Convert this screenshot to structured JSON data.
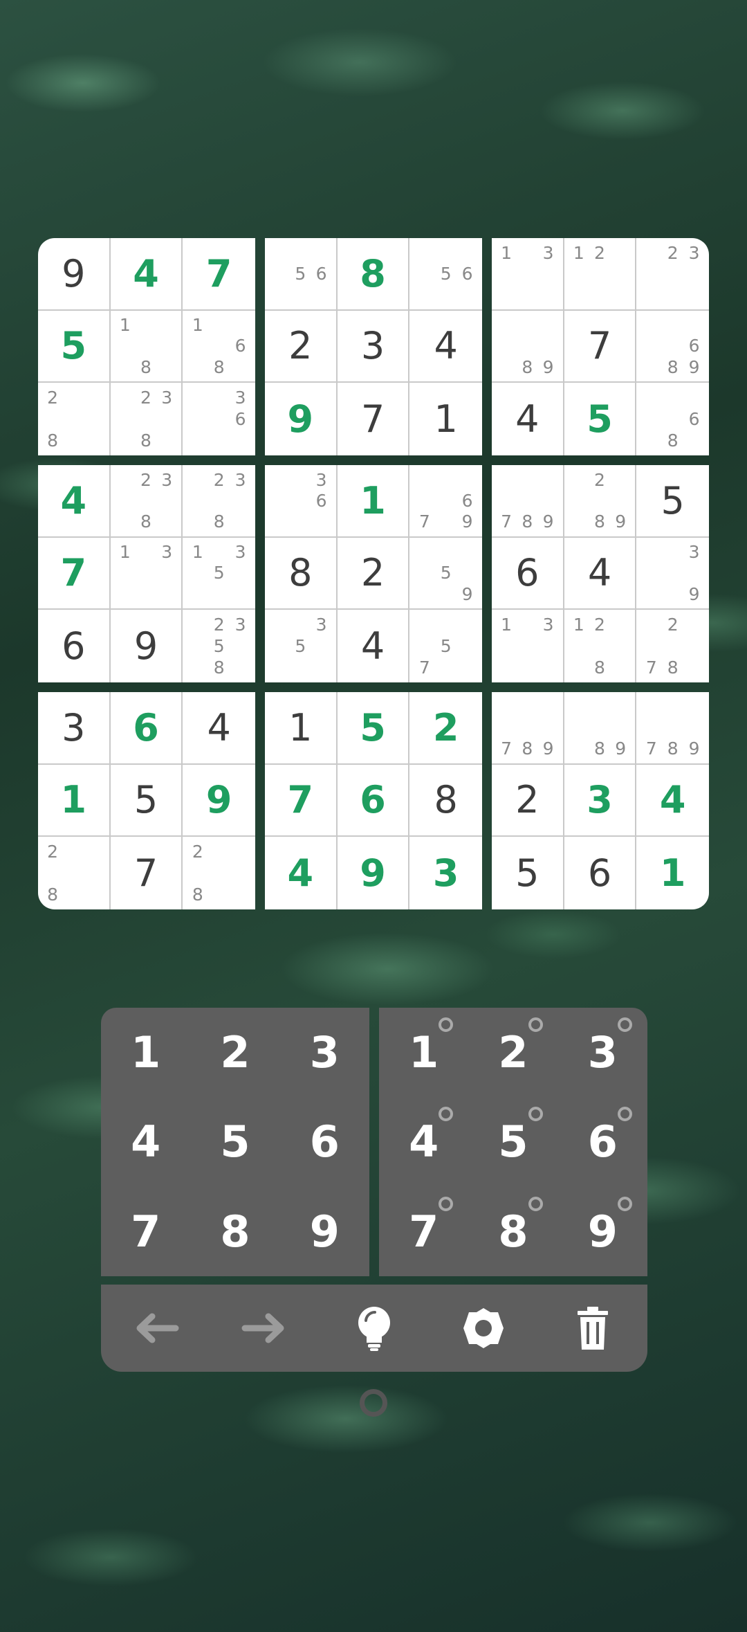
{
  "board": {
    "blocks": [
      {
        "cells": [
          {
            "v": "9",
            "t": "given"
          },
          {
            "v": "4",
            "t": "entered"
          },
          {
            "v": "7",
            "t": "entered"
          },
          {
            "v": "5",
            "t": "entered"
          },
          {
            "notes": [
              "1",
              "",
              "",
              "",
              "",
              "",
              "",
              "8",
              ""
            ]
          },
          {
            "notes": [
              "1",
              "",
              "",
              "",
              "",
              "6",
              "",
              "8",
              ""
            ]
          },
          {
            "notes": [
              "2",
              "",
              "",
              "",
              "",
              "",
              "8",
              "",
              ""
            ]
          },
          {
            "notes": [
              "",
              "2",
              "3",
              "",
              "",
              "",
              "",
              "8",
              ""
            ]
          },
          {
            "notes": [
              "",
              "",
              "3",
              "",
              "",
              "6",
              "",
              "",
              ""
            ]
          }
        ]
      },
      {
        "cells": [
          {
            "notes": [
              "",
              "",
              "",
              "",
              "5",
              "6",
              "",
              "",
              ""
            ]
          },
          {
            "v": "8",
            "t": "entered"
          },
          {
            "notes": [
              "",
              "",
              "",
              "",
              "5",
              "6",
              "",
              "",
              ""
            ]
          },
          {
            "v": "2",
            "t": "given"
          },
          {
            "v": "3",
            "t": "given"
          },
          {
            "v": "4",
            "t": "given"
          },
          {
            "v": "9",
            "t": "entered"
          },
          {
            "v": "7",
            "t": "given"
          },
          {
            "v": "1",
            "t": "given"
          }
        ]
      },
      {
        "cells": [
          {
            "notes": [
              "1",
              "",
              "3",
              "",
              "",
              "",
              "",
              "",
              ""
            ]
          },
          {
            "notes": [
              "1",
              "2",
              "",
              "",
              "",
              "",
              "",
              "",
              ""
            ]
          },
          {
            "notes": [
              "",
              "2",
              "3",
              "",
              "",
              "",
              "",
              "",
              ""
            ]
          },
          {
            "notes": [
              "",
              "",
              "",
              "",
              "",
              "",
              "",
              "8",
              "9"
            ]
          },
          {
            "v": "7",
            "t": "given"
          },
          {
            "notes": [
              "",
              "",
              "",
              "",
              "",
              "6",
              "",
              "8",
              "9"
            ]
          },
          {
            "v": "4",
            "t": "given"
          },
          {
            "v": "5",
            "t": "entered"
          },
          {
            "notes": [
              "",
              "",
              "",
              "",
              "",
              "6",
              "",
              "8",
              ""
            ]
          }
        ]
      },
      {
        "cells": [
          {
            "v": "4",
            "t": "entered"
          },
          {
            "notes": [
              "",
              "2",
              "3",
              "",
              "",
              "",
              "",
              "8",
              ""
            ]
          },
          {
            "notes": [
              "",
              "2",
              "3",
              "",
              "",
              "",
              "",
              "8",
              ""
            ]
          },
          {
            "v": "7",
            "t": "entered"
          },
          {
            "notes": [
              "1",
              "",
              "3",
              "",
              "",
              "",
              "",
              "",
              ""
            ]
          },
          {
            "notes": [
              "1",
              "",
              "3",
              "",
              "5",
              "",
              "",
              "",
              ""
            ]
          },
          {
            "v": "6",
            "t": "given"
          },
          {
            "v": "9",
            "t": "given"
          },
          {
            "notes": [
              "",
              "2",
              "3",
              "",
              "5",
              "",
              "",
              "8",
              ""
            ]
          }
        ]
      },
      {
        "cells": [
          {
            "notes": [
              "",
              "",
              "3",
              "",
              "",
              "6",
              "",
              "",
              ""
            ]
          },
          {
            "v": "1",
            "t": "entered"
          },
          {
            "notes": [
              "",
              "",
              "",
              "",
              "",
              "6",
              "7",
              "",
              "9"
            ]
          },
          {
            "v": "8",
            "t": "given"
          },
          {
            "v": "2",
            "t": "given"
          },
          {
            "notes": [
              "",
              "",
              "",
              "",
              "5",
              "",
              "",
              "",
              "9"
            ]
          },
          {
            "notes": [
              "",
              "",
              "3",
              "",
              "5",
              "",
              "",
              "",
              ""
            ]
          },
          {
            "v": "4",
            "t": "given"
          },
          {
            "notes": [
              "",
              "",
              "",
              "",
              "5",
              "",
              "7",
              "",
              ""
            ]
          }
        ]
      },
      {
        "cells": [
          {
            "notes": [
              "",
              "",
              "",
              "",
              "",
              "",
              "7",
              "8",
              "9"
            ]
          },
          {
            "notes": [
              "",
              "2",
              "",
              "",
              "",
              "",
              "",
              "8",
              "9"
            ]
          },
          {
            "v": "5",
            "t": "given"
          },
          {
            "v": "6",
            "t": "given"
          },
          {
            "v": "4",
            "t": "given"
          },
          {
            "notes": [
              "",
              "",
              "3",
              "",
              "",
              "",
              "",
              "",
              "9"
            ]
          },
          {
            "notes": [
              "1",
              "",
              "3",
              "",
              "",
              "",
              "",
              "",
              ""
            ]
          },
          {
            "notes": [
              "1",
              "2",
              "",
              "",
              "",
              "",
              "",
              "8",
              ""
            ]
          },
          {
            "notes": [
              "",
              "2",
              "",
              "",
              "",
              "",
              "7",
              "8",
              ""
            ]
          }
        ]
      },
      {
        "cells": [
          {
            "v": "3",
            "t": "given"
          },
          {
            "v": "6",
            "t": "entered"
          },
          {
            "v": "4",
            "t": "given"
          },
          {
            "v": "1",
            "t": "entered"
          },
          {
            "v": "5",
            "t": "given"
          },
          {
            "v": "9",
            "t": "entered"
          },
          {
            "notes": [
              "2",
              "",
              "",
              "",
              "",
              "",
              "8",
              "",
              ""
            ]
          },
          {
            "v": "7",
            "t": "given"
          },
          {
            "notes": [
              "2",
              "",
              "",
              "",
              "",
              "",
              "8",
              "",
              ""
            ]
          }
        ]
      },
      {
        "cells": [
          {
            "v": "1",
            "t": "given"
          },
          {
            "v": "5",
            "t": "entered"
          },
          {
            "v": "2",
            "t": "entered"
          },
          {
            "v": "7",
            "t": "entered"
          },
          {
            "v": "6",
            "t": "entered"
          },
          {
            "v": "8",
            "t": "given"
          },
          {
            "v": "4",
            "t": "entered"
          },
          {
            "v": "9",
            "t": "entered"
          },
          {
            "v": "3",
            "t": "entered"
          }
        ]
      },
      {
        "cells": [
          {
            "notes": [
              "",
              "",
              "",
              "",
              "",
              "",
              "7",
              "8",
              "9"
            ]
          },
          {
            "notes": [
              "",
              "",
              "",
              "",
              "",
              "",
              "",
              "8",
              "9"
            ]
          },
          {
            "notes": [
              "",
              "",
              "",
              "",
              "",
              "",
              "7",
              "8",
              "9"
            ]
          },
          {
            "v": "2",
            "t": "given"
          },
          {
            "v": "3",
            "t": "entered"
          },
          {
            "v": "4",
            "t": "entered"
          },
          {
            "v": "5",
            "t": "given"
          },
          {
            "v": "6",
            "t": "given"
          },
          {
            "v": "1",
            "t": "entered"
          }
        ]
      }
    ]
  },
  "number_pad": {
    "keys": [
      "1",
      "2",
      "3",
      "4",
      "5",
      "6",
      "7",
      "8",
      "9"
    ]
  },
  "notes_pad": {
    "keys": [
      "1",
      "2",
      "3",
      "4",
      "5",
      "6",
      "7",
      "8",
      "9"
    ]
  },
  "toolbar": {
    "tools": [
      {
        "name": "undo-arrow-icon",
        "icon": "arrow-left"
      },
      {
        "name": "redo-arrow-icon",
        "icon": "arrow-right"
      },
      {
        "name": "hint-lightbulb-icon",
        "icon": "lightbulb"
      },
      {
        "name": "settings-gear-icon",
        "icon": "gear"
      },
      {
        "name": "delete-trash-icon",
        "icon": "trash"
      }
    ]
  },
  "colors": {
    "given": "#3d3d3d",
    "entered": "#1e9e5f",
    "notes": "#888888",
    "pad": "#5e5e5e"
  }
}
